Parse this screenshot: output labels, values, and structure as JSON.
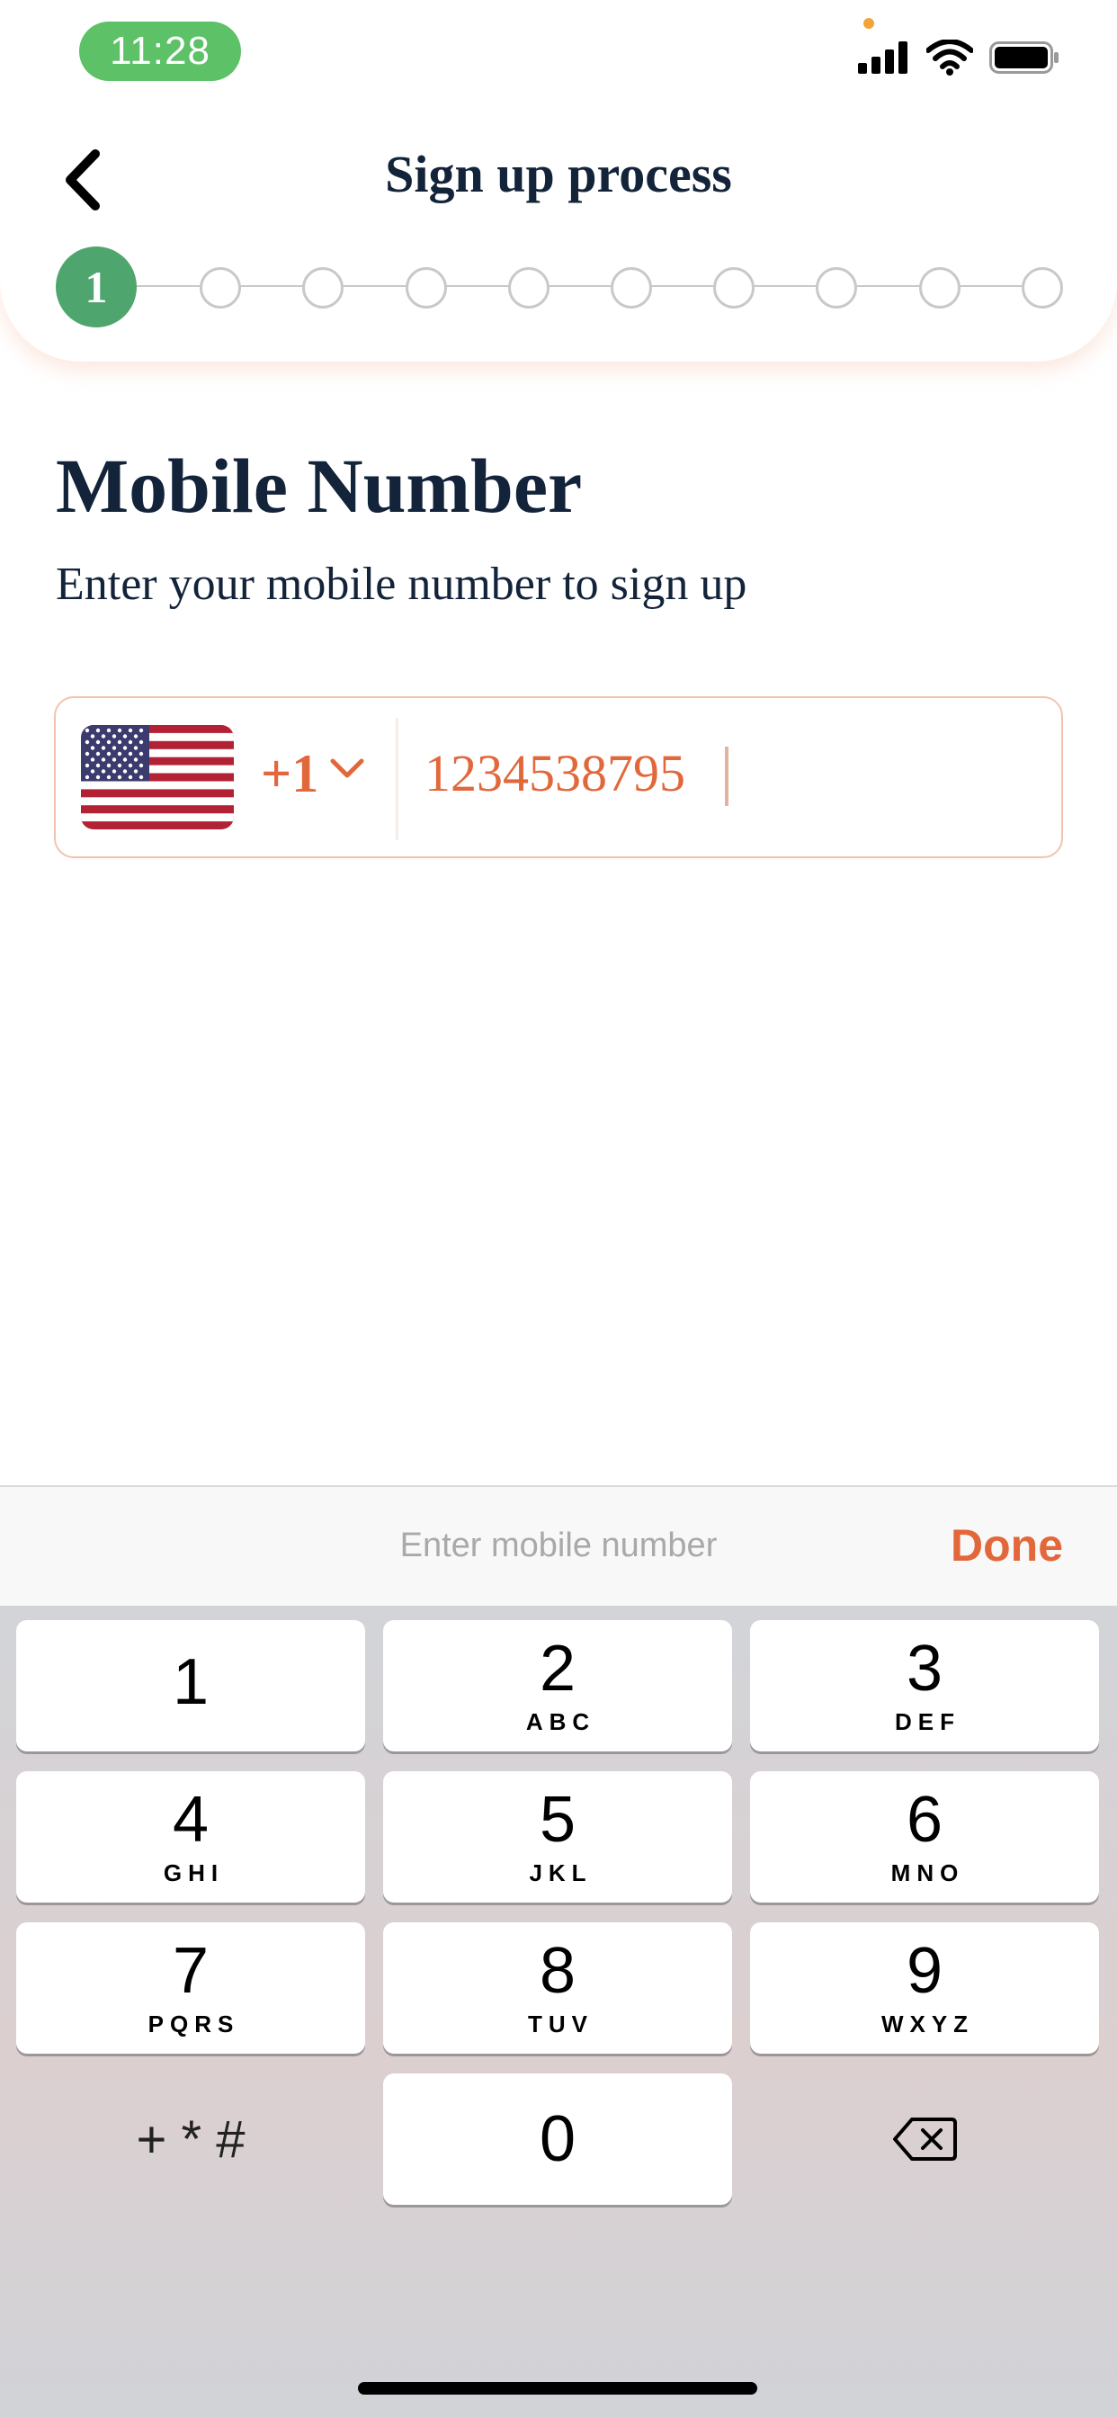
{
  "status_bar": {
    "time": "11:28",
    "icons": [
      "orange-dot",
      "signal-icon",
      "wifi-icon",
      "battery-icon"
    ],
    "time_pill_color": "#5cc167"
  },
  "header": {
    "title": "Sign up process",
    "back_icon": "chevron-left-icon",
    "stepper": {
      "current_step": "1",
      "total_steps": 10
    }
  },
  "main": {
    "title": "Mobile Number",
    "subtitle": "Enter your mobile number to sign up",
    "phone_field": {
      "country_flag": "us-flag-icon",
      "country_code": "+1",
      "value": "1234538795"
    }
  },
  "keyboard": {
    "accessory_placeholder": "Enter mobile number",
    "done_label": "Done",
    "keys": [
      {
        "digit": "1",
        "letters": ""
      },
      {
        "digit": "2",
        "letters": "ABC"
      },
      {
        "digit": "3",
        "letters": "DEF"
      },
      {
        "digit": "4",
        "letters": "GHI"
      },
      {
        "digit": "5",
        "letters": "JKL"
      },
      {
        "digit": "6",
        "letters": "MNO"
      },
      {
        "digit": "7",
        "letters": "PQRS"
      },
      {
        "digit": "8",
        "letters": "TUV"
      },
      {
        "digit": "9",
        "letters": "WXYZ"
      },
      {
        "digit": "0",
        "letters": ""
      }
    ],
    "symbols_key": "+ * #",
    "delete_icon": "backspace-icon"
  },
  "colors": {
    "accent": "#e2673a",
    "step_active": "#4ea56d",
    "heading": "#12233a"
  }
}
